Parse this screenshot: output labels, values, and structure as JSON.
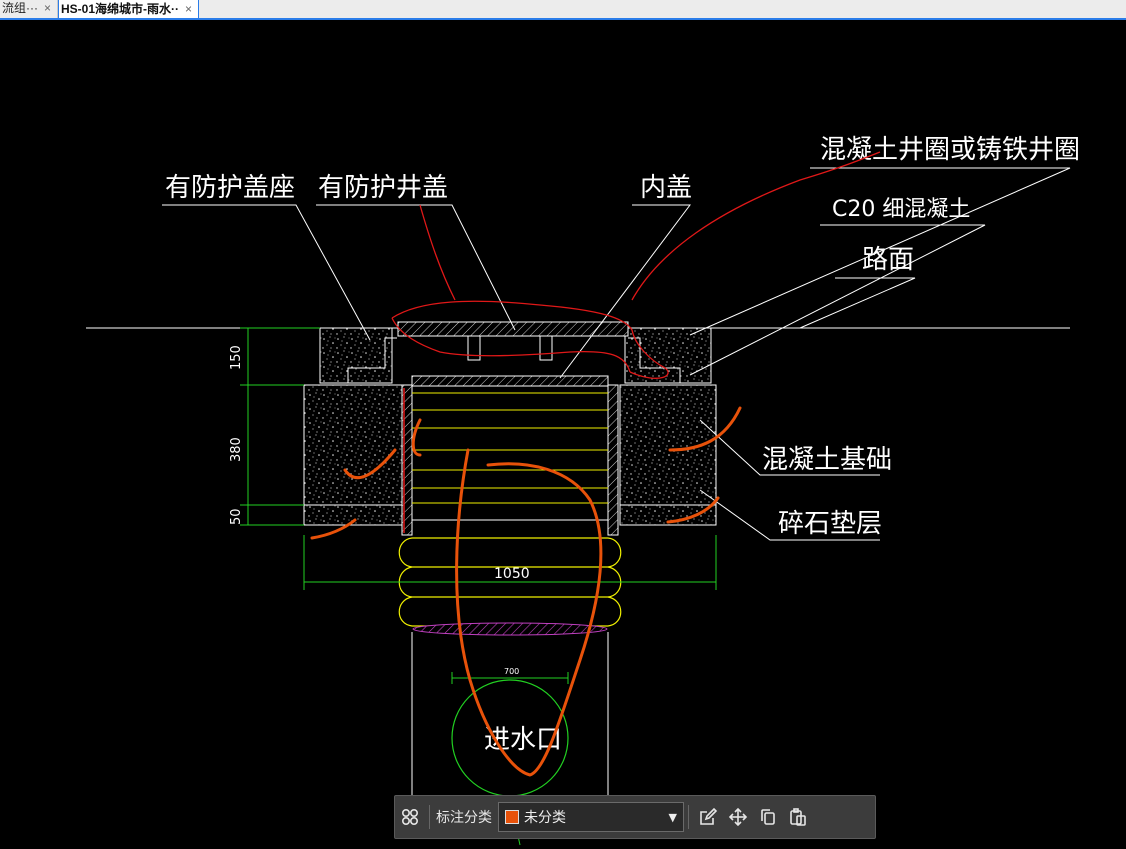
{
  "tabs": [
    {
      "label": "流组···",
      "close": "×",
      "active": false
    },
    {
      "label": "HS-01海绵城市-雨水··",
      "close": "×",
      "active": true
    }
  ],
  "drawing": {
    "labels": {
      "cover_seat": "有防护盖座",
      "manhole_cover": "有防护井盖",
      "inner_cover": "内盖",
      "ring": "混凝土井圈或铸铁井圈",
      "c20": "C20 细混凝土",
      "road": "路面",
      "foundation": "混凝土基础",
      "gravel": "碎石垫层",
      "inlet": "进水口"
    },
    "dims": {
      "d150": "150",
      "d380": "380",
      "d50": "50",
      "d1050": "1050",
      "small": "700"
    }
  },
  "toolbar": {
    "grid_icon": "grid-icon",
    "category_label": "标注分类",
    "category_value": "未分类",
    "category_color": "#e8520a",
    "icons": [
      "edit-icon",
      "move-icon",
      "copy-icon",
      "paste-icon"
    ]
  },
  "colors": {
    "background": "#000000",
    "annotation_orange": "#e8520a",
    "annotation_red": "#e01818",
    "dim_green": "#22d022",
    "yellow": "#f0f000",
    "magenta": "#c040c0"
  }
}
